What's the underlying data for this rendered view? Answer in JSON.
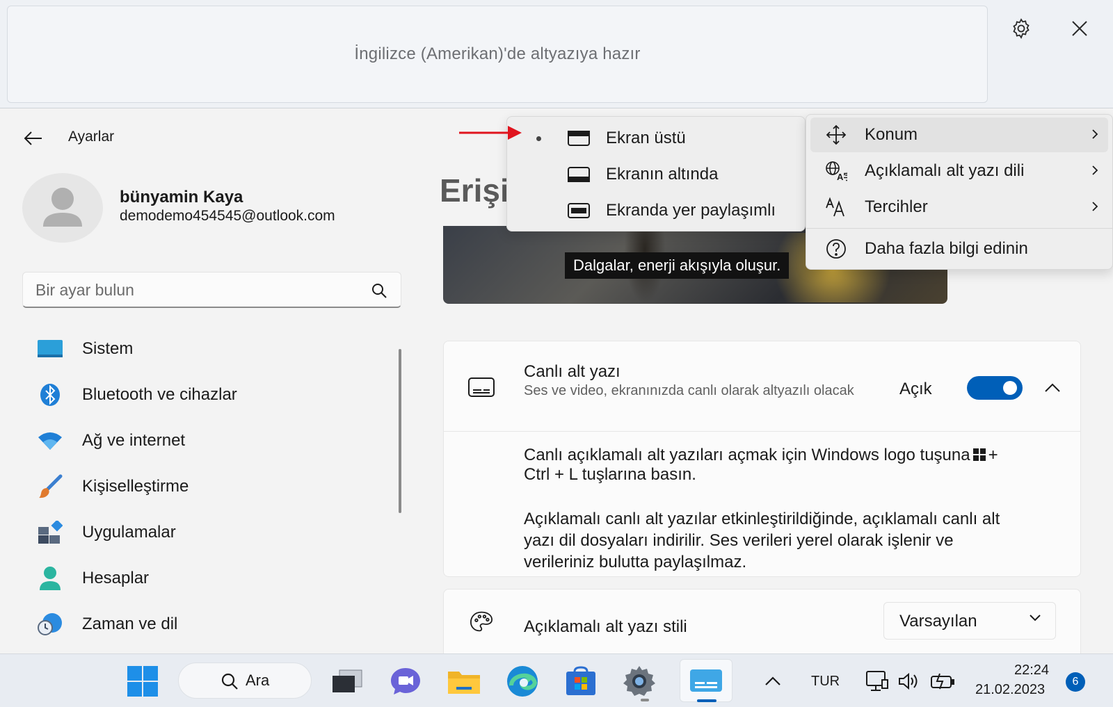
{
  "live_caption": {
    "text": "İngilizce (Amerikan)'de altyazıya hazır",
    "settings_icon": "gear-icon",
    "close_icon": "close-icon"
  },
  "settings": {
    "title": "Ayarlar",
    "user": {
      "name": "bünyamin Kaya",
      "email": "demodemo454545@outlook.com"
    },
    "search": {
      "placeholder": "Bir ayar bulun"
    },
    "nav": [
      {
        "label": "Sistem",
        "icon": "monitor-icon"
      },
      {
        "label": "Bluetooth ve cihazlar",
        "icon": "bluetooth-icon"
      },
      {
        "label": "Ağ ve internet",
        "icon": "wifi-icon"
      },
      {
        "label": "Kişiselleştirme",
        "icon": "brush-icon"
      },
      {
        "label": "Uygulamalar",
        "icon": "apps-icon"
      },
      {
        "label": "Hesaplar",
        "icon": "person-icon"
      },
      {
        "label": "Zaman ve dil",
        "icon": "globe-clock-icon"
      }
    ],
    "page_title": "Erişi",
    "hero_caption": "Dalgalar, enerji akışıyla oluşur.",
    "live_captions_card": {
      "title": "Canlı alt yazı",
      "description": "Ses ve video, ekranınızda canlı olarak altyazılı olacak",
      "toggle_label": "Açık",
      "toggle_on": true,
      "body_1a": "Canlı açıklamalı alt yazıları açmak için Windows logo tuşuna",
      "body_1b": "+ Ctrl + L tuşlarına basın.",
      "body_2": "Açıklamalı canlı alt yazılar etkinleştirildiğinde, açıklamalı canlı alt yazı dil dosyaları indirilir. Ses verileri yerel olarak işlenir ve verileriniz bulutta paylaşılmaz."
    },
    "caption_style_card": {
      "title": "Açıklamalı alt yazı stili",
      "selected": "Varsayılan"
    }
  },
  "position_menu": {
    "items": [
      {
        "label": "Ekran üstü",
        "selected": true,
        "icon": "window-top-icon"
      },
      {
        "label": "Ekranın altında",
        "selected": false,
        "icon": "window-bottom-icon"
      },
      {
        "label": "Ekranda yer paylaşımlı",
        "selected": false,
        "icon": "window-overlay-icon"
      }
    ]
  },
  "options_menu": {
    "items": [
      {
        "label": "Konum",
        "icon": "move-icon",
        "submenu": true
      },
      {
        "label": "Açıklamalı alt yazı dili",
        "icon": "language-icon",
        "submenu": true
      },
      {
        "label": "Tercihler",
        "icon": "text-size-icon",
        "submenu": true
      },
      {
        "label": "Daha fazla bilgi edinin",
        "icon": "help-icon",
        "submenu": false
      }
    ]
  },
  "taskbar": {
    "search_label": "Ara",
    "language": "TUR",
    "time": "22:24",
    "date": "21.02.2023",
    "notification_count": "6"
  },
  "colors": {
    "accent": "#005fb8",
    "annotation_arrow": "#e0141e"
  }
}
